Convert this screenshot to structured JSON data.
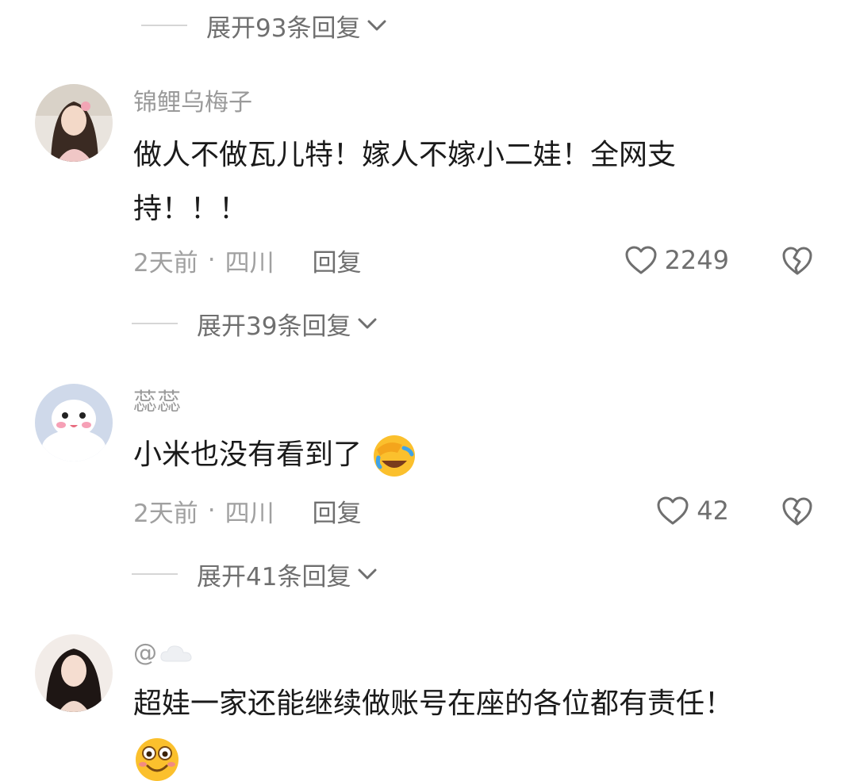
{
  "expand_top": {
    "label": "展开93条回复"
  },
  "comments": [
    {
      "username": "锦鲤乌梅子",
      "content_line1": "做人不做瓦儿特！嫁人不嫁小二娃！全网支",
      "content_line2": "持！！！",
      "time": "2天前",
      "location": "四川",
      "reply_label": "回复",
      "likes": "2249",
      "expand_label": "展开39条回复"
    },
    {
      "username": "蕊蕊",
      "content": "小米也没有看到了",
      "emoji": "facepalm-laugh-emoji",
      "time": "2天前",
      "location": "四川",
      "reply_label": "回复",
      "likes": "42",
      "expand_label": "展开41条回复"
    },
    {
      "username": "@",
      "content": "超娃一家还能继续做账号在座的各位都有责任！",
      "emoji": "smile-emoji"
    }
  ],
  "separator": "·",
  "colors": {
    "text": "#1a1a1a",
    "muted": "#9a9a9a",
    "secondary": "#6f6f6f"
  }
}
